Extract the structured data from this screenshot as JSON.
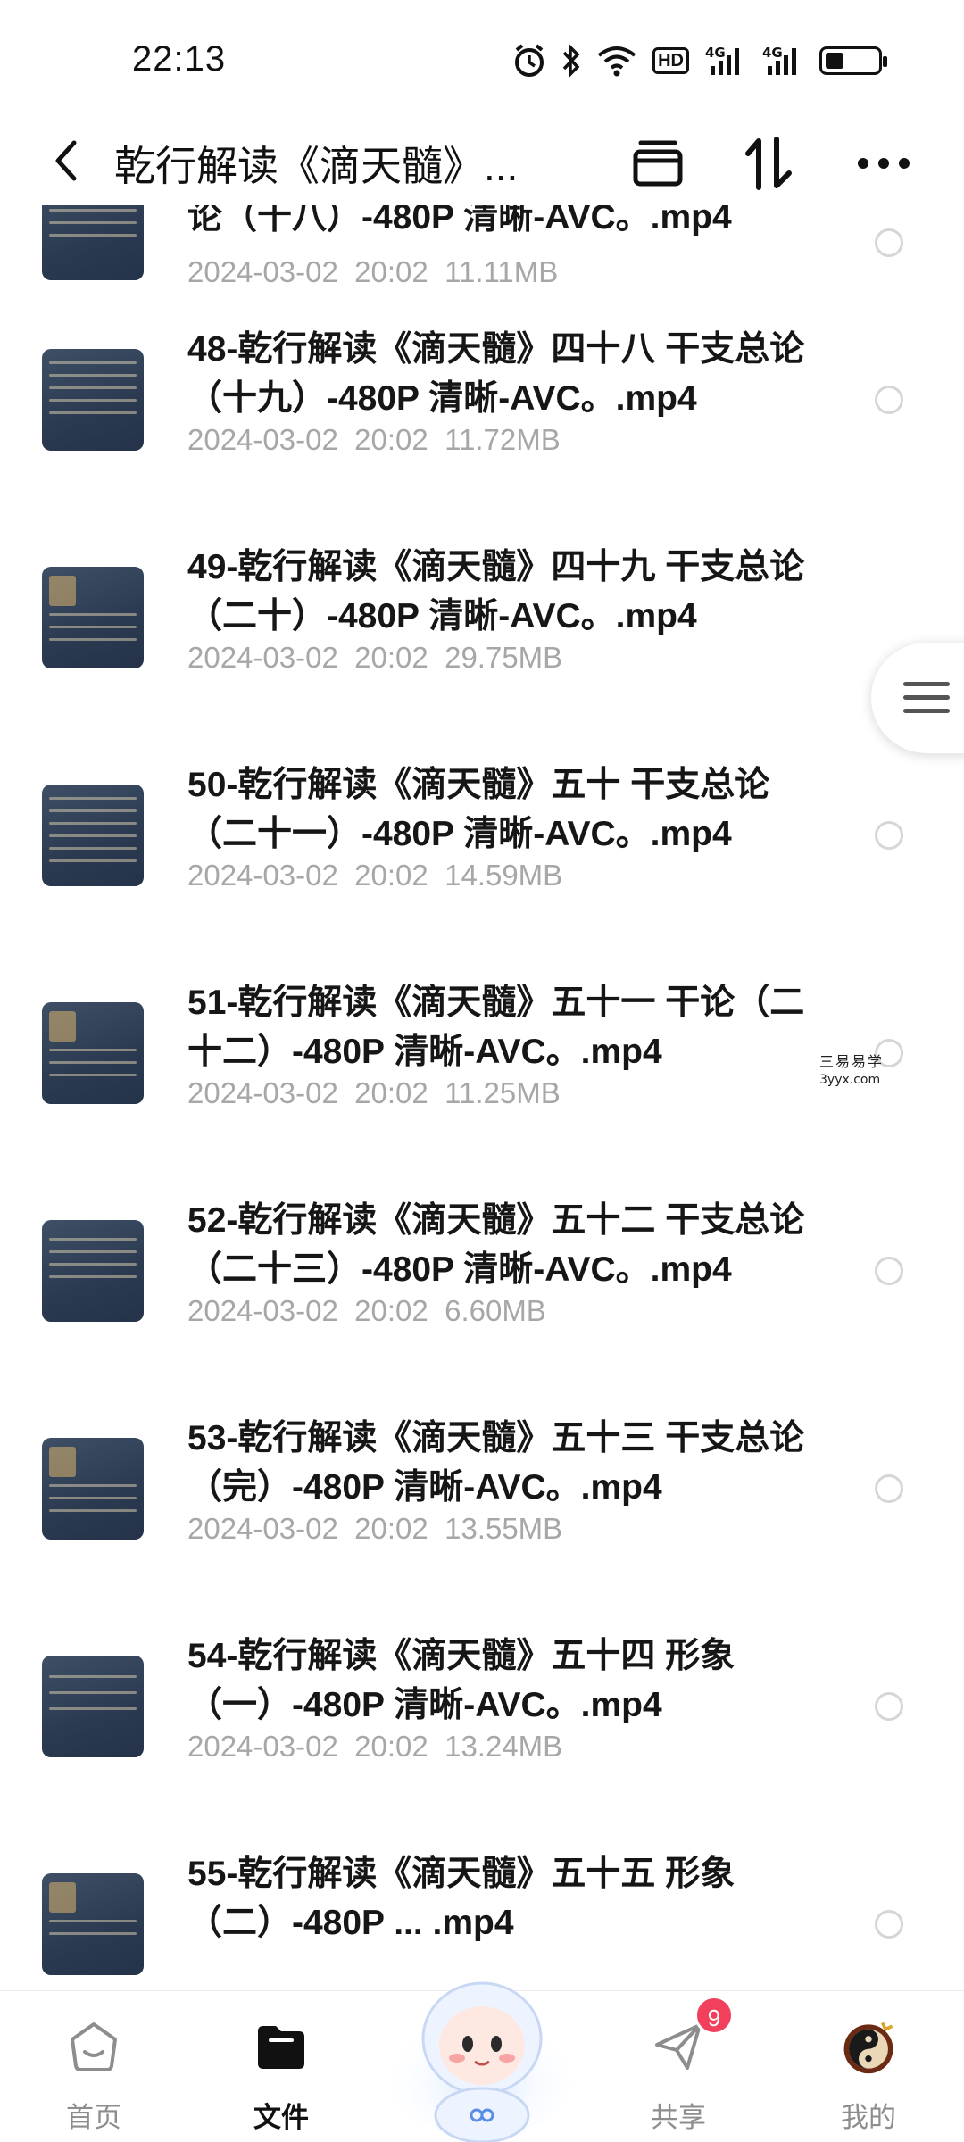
{
  "status_bar": {
    "time": "22:13",
    "icons": [
      "alarm-icon",
      "bluetooth-icon",
      "wifi-icon",
      "hd-icon",
      "signal-4g-icon",
      "signal-4g-icon",
      "battery-icon"
    ],
    "hd_label": "HD",
    "net_label": "4G",
    "battery_level": 0.35
  },
  "header": {
    "title": "乾行解读《滴天髓》...",
    "back_icon": "chevron-left-icon",
    "actions": [
      "archive-box-icon",
      "sort-icon",
      "more-icon"
    ]
  },
  "files": [
    {
      "name": "论（十八）-480P 清晰-AVC。.mp4",
      "date": "2024-03-02",
      "time": "20:02",
      "size": "11.11MB"
    },
    {
      "name": "48-乾行解读《滴天髓》四十八 干支总论（十九）-480P 清晰-AVC。.mp4",
      "date": "2024-03-02",
      "time": "20:02",
      "size": "11.72MB"
    },
    {
      "name": "49-乾行解读《滴天髓》四十九 干支总论（二十）-480P 清晰-AVC。.mp4",
      "date": "2024-03-02",
      "time": "20:02",
      "size": "29.75MB"
    },
    {
      "name": "50-乾行解读《滴天髓》五十 干支总论（二十一）-480P 清晰-AVC。.mp4",
      "date": "2024-03-02",
      "time": "20:02",
      "size": "14.59MB"
    },
    {
      "name": "51-乾行解读《滴天髓》五十一 干论（二十二）-480P 清晰-AVC。.mp4",
      "date": "2024-03-02",
      "time": "20:02",
      "size": "11.25MB"
    },
    {
      "name": "52-乾行解读《滴天髓》五十二 干支总论（二十三）-480P 清晰-AVC。.mp4",
      "date": "2024-03-02",
      "time": "20:02",
      "size": "6.60MB"
    },
    {
      "name": "53-乾行解读《滴天髓》五十三 干支总论（完）-480P 清晰-AVC。.mp4",
      "date": "2024-03-02",
      "time": "20:02",
      "size": "13.55MB"
    },
    {
      "name": "54-乾行解读《滴天髓》五十四 形象（一）-480P 清晰-AVC。.mp4",
      "date": "2024-03-02",
      "time": "20:02",
      "size": "13.24MB"
    },
    {
      "name": "55-乾行解读《滴天髓》五十五 形象（二）-480P ... .mp4",
      "date": "",
      "time": "",
      "size": ""
    }
  ],
  "watermark": {
    "line1": "三易易学",
    "line2": "3yyx.com"
  },
  "bottom_nav": {
    "items": [
      {
        "label": "首页",
        "icon": "home-icon",
        "active": false
      },
      {
        "label": "文件",
        "icon": "folder-icon",
        "active": true
      },
      {
        "label": "共享",
        "icon": "share-plane-icon",
        "active": false
      },
      {
        "label": "我的",
        "icon": "profile-avatar-icon",
        "active": false
      }
    ],
    "share_badge": "9",
    "mascot_icon": "mascot-assistant-icon"
  },
  "colors": {
    "accent_badge": "#f2405c",
    "meta_text": "#a7a7a7",
    "thumb_bg": "#2f3e55"
  }
}
